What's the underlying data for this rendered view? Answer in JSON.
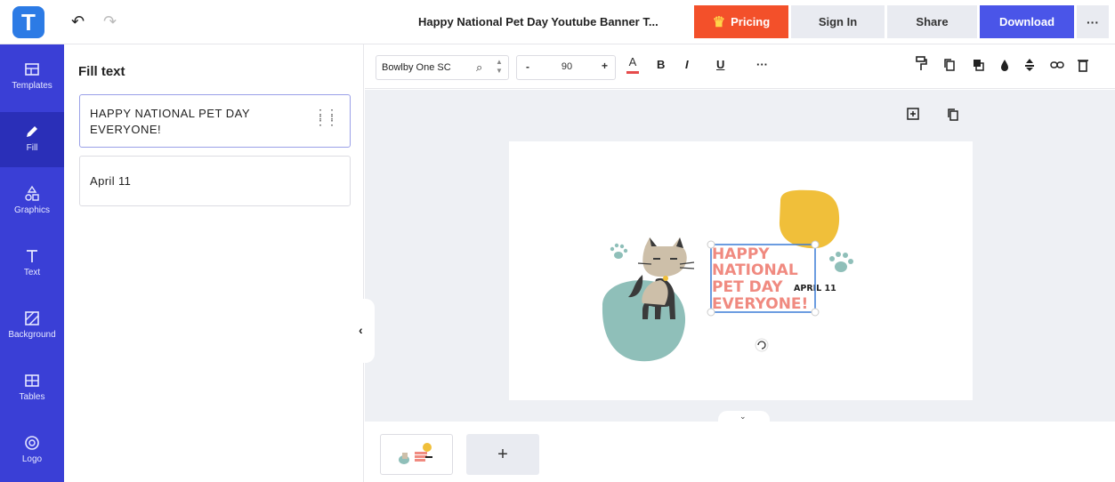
{
  "header": {
    "logo_letter": "T",
    "title": "Happy National Pet Day Youtube Banner T...",
    "pricing_label": "Pricing",
    "signin_label": "Sign In",
    "share_label": "Share",
    "download_label": "Download",
    "more_label": "···"
  },
  "sidebar": {
    "items": [
      {
        "label": "Templates",
        "icon": "templates-icon"
      },
      {
        "label": "Fill",
        "icon": "pencil-icon"
      },
      {
        "label": "Graphics",
        "icon": "shapes-icon"
      },
      {
        "label": "Text",
        "icon": "text-icon"
      },
      {
        "label": "Background",
        "icon": "background-icon"
      },
      {
        "label": "Tables",
        "icon": "table-icon"
      },
      {
        "label": "Logo",
        "icon": "logo-icon"
      }
    ],
    "active": "Fill"
  },
  "panel": {
    "title": "Fill text",
    "fields": [
      {
        "value": "HAPPY NATIONAL PET DAY EVERYONE!"
      },
      {
        "value": "April 11"
      }
    ]
  },
  "toolbar": {
    "font_name": "Bowlby One SC",
    "font_size": "90",
    "minus": "-",
    "plus": "+",
    "color_glyph": "A",
    "bold": "B",
    "italic": "I",
    "underline": "U",
    "more": "···",
    "text_color": "#e64b4b"
  },
  "design": {
    "headline_lines": [
      "HAPPY",
      "NATIONAL",
      "PET DAY",
      "EVERYONE!"
    ],
    "date_text": "APRIL 11",
    "colors": {
      "headline": "#f08a80",
      "date": "#222222",
      "sun": "#f0bf3a",
      "blob": "#8fbfb9",
      "paw": "#8fbfb9",
      "cat_body": "#cdbfa9",
      "cat_dark": "#3a3a3a",
      "selection": "#3a7bd5"
    }
  },
  "pages": {
    "add_label": "+"
  },
  "colors": {
    "rail": "#3a3fd6",
    "pricing": "#f3502a",
    "download": "#4a55e8"
  }
}
